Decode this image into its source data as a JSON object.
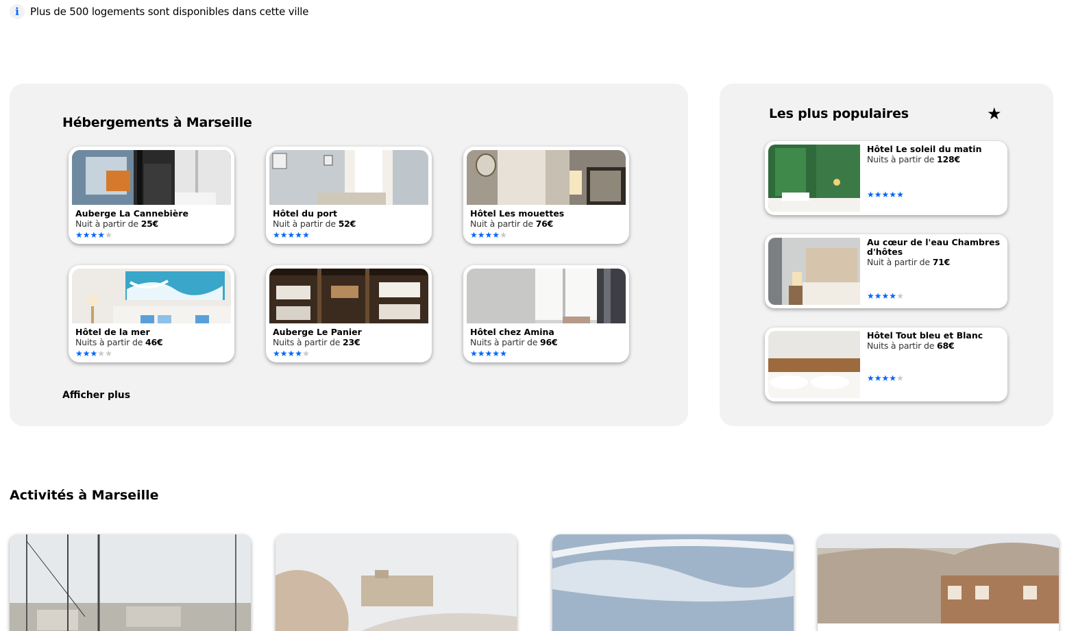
{
  "info": {
    "icon": "info-icon",
    "text": "Plus de 500 logements sont disponibles dans cette ville"
  },
  "hebergements": {
    "title": "Hébergements à Marseille",
    "more_label": "Afficher plus",
    "cards": [
      {
        "name": "Auberge La Cannebière",
        "price_prefix": "Nuit à partir de ",
        "price": "25€",
        "rating": 4
      },
      {
        "name": "Hôtel du port",
        "price_prefix": "Nuit à partir de ",
        "price": "52€",
        "rating": 5
      },
      {
        "name": "Hôtel Les mouettes",
        "price_prefix": "Nuit à partir de ",
        "price": "76€",
        "rating": 4
      },
      {
        "name": "Hôtel de la mer",
        "price_prefix": "Nuits à partir de ",
        "price": "46€",
        "rating": 3
      },
      {
        "name": "Auberge Le Panier",
        "price_prefix": "Nuits à partir de ",
        "price": "23€",
        "rating": 4
      },
      {
        "name": "Hôtel chez Amina",
        "price_prefix": "Nuits à partir de ",
        "price": "96€",
        "rating": 5
      }
    ]
  },
  "populaires": {
    "title": "Les plus populaires",
    "icon": "star-icon",
    "cards": [
      {
        "name": "Hôtel Le soleil du matin",
        "price_prefix": "Nuits à partir de ",
        "price": "128€",
        "rating": 5
      },
      {
        "name": "Au cœur de l'eau Chambres d'hôtes",
        "price_prefix": "Nuit à partir de ",
        "price": "71€",
        "rating": 4
      },
      {
        "name": "Hôtel Tout bleu et Blanc",
        "price_prefix": "Nuits à partir de ",
        "price": "68€",
        "rating": 4
      }
    ]
  },
  "activites": {
    "title": "Activités à Marseille"
  },
  "colors": {
    "accent": "#0065fc",
    "panel": "#f2f2f2",
    "star_off": "#c8c8c8"
  }
}
